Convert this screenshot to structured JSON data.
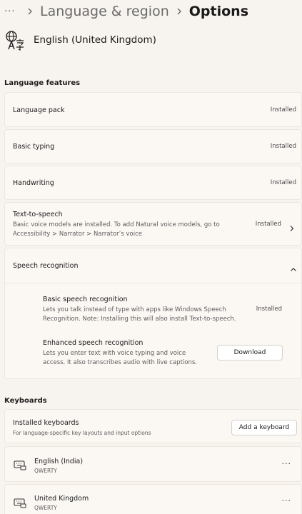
{
  "breadcrumb": {
    "more": "···",
    "items": [
      "Language & region",
      "Options"
    ]
  },
  "language": {
    "icon": "language-icon",
    "name": "English (United Kingdom)"
  },
  "language_features": {
    "title": "Language features",
    "items": [
      {
        "label": "Language pack",
        "status": "Installed"
      },
      {
        "label": "Basic typing",
        "status": "Installed"
      },
      {
        "label": "Handwriting",
        "status": "Installed"
      },
      {
        "label": "Text-to-speech",
        "description_line1": "Basic voice models are installed. To add Natural voice models, go to",
        "description_line2": "Accessibility > Narrator > Narrator’s voice",
        "status": "Installed"
      }
    ],
    "speech": {
      "label": "Speech recognition",
      "basic": {
        "label": "Basic speech recognition",
        "description_line1": "Lets you talk instead of type with apps like Windows Speech",
        "description_line2": "Recognition. Note: Installing this will also install Text-to-speech.",
        "status": "Installed"
      },
      "enhanced": {
        "label": "Enhanced speech recognition",
        "description_line1": "Lets you enter text with voice typing and voice",
        "description_line2": "access. It also transcribes audio with live captions.",
        "button": "Download"
      }
    }
  },
  "keyboards": {
    "title": "Keyboards",
    "installed": {
      "label": "Installed keyboards",
      "description": "For language-specific key layouts and input options",
      "button": "Add a keyboard"
    },
    "items": [
      {
        "name": "English (India)",
        "layout": "QWERTY",
        "more": "···"
      },
      {
        "name": "United Kingdom",
        "layout": "QWERTY",
        "more": "···"
      }
    ]
  },
  "colors": {
    "background": "#f7f3ee",
    "card": "#fbf8f4",
    "border": "#ece6de"
  }
}
